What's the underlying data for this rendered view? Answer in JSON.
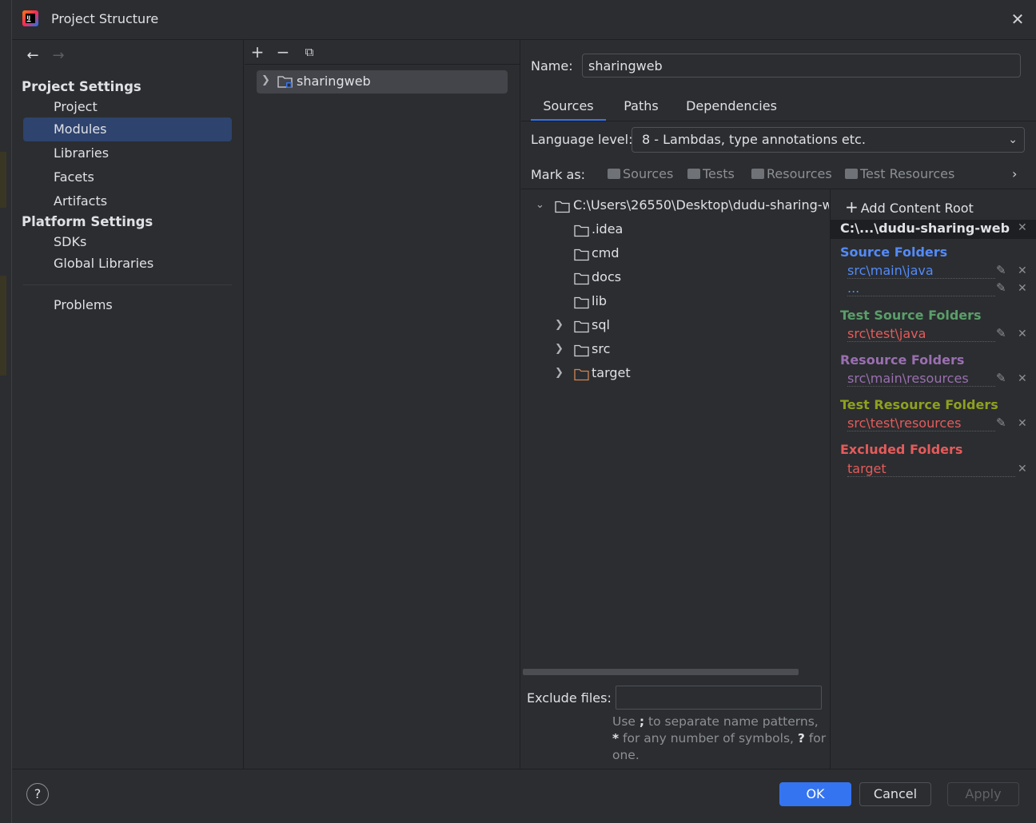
{
  "window": {
    "title": "Project Structure"
  },
  "nav": {
    "project_settings": "Project Settings",
    "project_items": [
      "Project",
      "Modules",
      "Libraries",
      "Facets",
      "Artifacts"
    ],
    "platform_settings": "Platform Settings",
    "platform_items": [
      "SDKs",
      "Global Libraries"
    ],
    "problems": "Problems",
    "selected": "Modules"
  },
  "modules": {
    "items": [
      {
        "name": "sharingweb"
      }
    ]
  },
  "module": {
    "name_label": "Name:",
    "name_value": "sharingweb",
    "tabs": [
      "Sources",
      "Paths",
      "Dependencies"
    ],
    "active_tab": "Sources",
    "language_label": "Language level:",
    "language_value": "8 - Lambdas, type annotations etc.",
    "mark_as_label": "Mark as:",
    "mark_as": [
      "Sources",
      "Tests",
      "Resources",
      "Test Resources"
    ]
  },
  "tree": {
    "root": "C:\\Users\\26550\\Desktop\\dudu-sharing-w",
    "children": [
      {
        "name": ".idea",
        "expandable": false
      },
      {
        "name": "cmd",
        "expandable": false
      },
      {
        "name": "docs",
        "expandable": false
      },
      {
        "name": "lib",
        "expandable": false
      },
      {
        "name": "sql",
        "expandable": true
      },
      {
        "name": "src",
        "expandable": true
      },
      {
        "name": "target",
        "expandable": true,
        "excluded": true
      }
    ]
  },
  "exclude": {
    "label": "Exclude files:",
    "value": "",
    "help_1": "Use ",
    "help_semicolon": ";",
    "help_2": " to separate name patterns, ",
    "help_star": "*",
    "help_3": " for any number of symbols, ",
    "help_q": "?",
    "help_4": " for one."
  },
  "roots": {
    "add_label": "Add Content Root",
    "root_path": "C:\\...\\dudu-sharing-web",
    "groups": [
      {
        "title": "Source Folders",
        "entries": [
          "src\\main\\java",
          "..."
        ]
      },
      {
        "title": "Test Source Folders",
        "entries": [
          "src\\test\\java"
        ]
      },
      {
        "title": "Resource Folders",
        "entries": [
          "src\\main\\resources"
        ]
      },
      {
        "title": "Test Resource Folders",
        "entries": [
          "src\\test\\resources"
        ]
      },
      {
        "title": "Excluded Folders",
        "entries": [
          "target"
        ]
      }
    ]
  },
  "buttons": {
    "ok": "OK",
    "cancel": "Cancel",
    "apply": "Apply",
    "help": "?"
  },
  "colors": {
    "accent": "#3574f0",
    "source": "#548af7",
    "test_source": "#5b9e6a",
    "resource": "#9a6fb0",
    "test_resource": "#8fa11e",
    "excluded": "#e55b5b",
    "test_entry": "#e55b5b",
    "folder_excluded": "#d08555"
  }
}
